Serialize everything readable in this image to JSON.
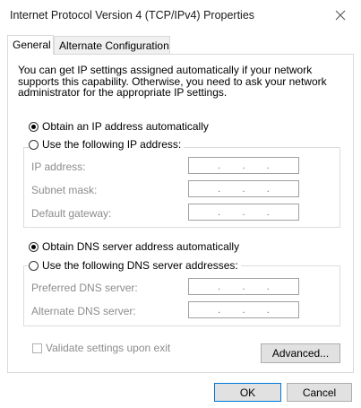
{
  "window": {
    "title": "Internet Protocol Version 4 (TCP/IPv4) Properties"
  },
  "tabs": [
    {
      "label": "General",
      "active": true
    },
    {
      "label": "Alternate Configuration",
      "active": false
    }
  ],
  "description": "You can get IP settings assigned automatically if your network supports this capability. Otherwise, you need to ask your network administrator for the appropriate IP settings.",
  "ip_mode": {
    "auto_label": "Obtain an IP address automatically",
    "manual_label": "Use the following IP address:",
    "selected": "auto"
  },
  "ip_fields": {
    "ip_address_label": "IP address:",
    "subnet_mask_label": "Subnet mask:",
    "default_gateway_label": "Default gateway:"
  },
  "dns_mode": {
    "auto_label": "Obtain DNS server address automatically",
    "manual_label": "Use the following DNS server addresses:",
    "selected": "auto"
  },
  "dns_fields": {
    "preferred_label": "Preferred DNS server:",
    "alternate_label": "Alternate DNS server:"
  },
  "ip_separator": ".",
  "validate_label": "Validate settings upon exit",
  "buttons": {
    "advanced": "Advanced...",
    "ok": "OK",
    "cancel": "Cancel"
  }
}
